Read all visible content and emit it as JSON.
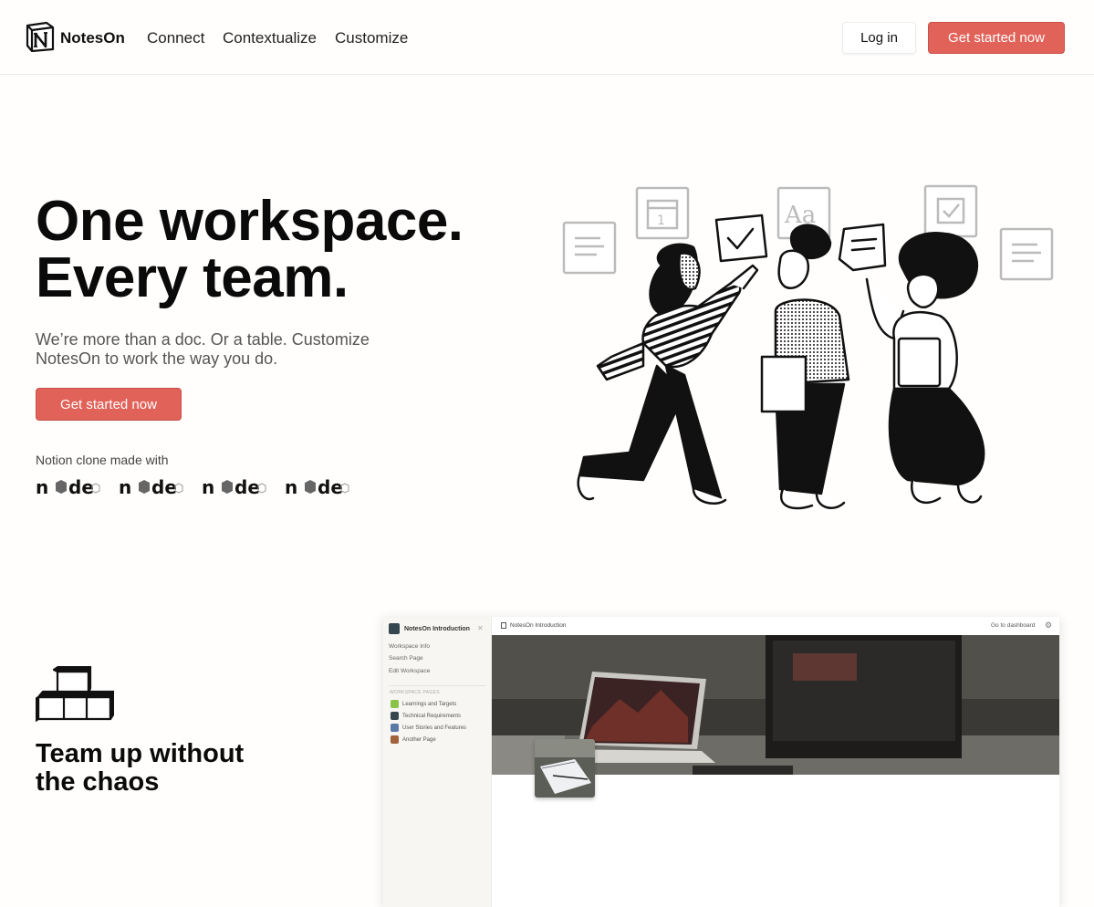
{
  "header": {
    "brand": "NotesOn",
    "nav": [
      "Connect",
      "Contextualize",
      "Customize"
    ],
    "login_label": "Log in",
    "cta_label": "Get started now"
  },
  "hero": {
    "title_line1": "One workspace.",
    "title_line2": "Every team.",
    "subtitle": "We’re more than a doc. Or a table. Customize NotesOn to work the way you do.",
    "cta_label": "Get started now",
    "made_with": "Notion clone made with",
    "tech_logos": [
      "node",
      "node",
      "node",
      "node"
    ]
  },
  "section2": {
    "title_line1": "Team up without",
    "title_line2": "the chaos"
  },
  "app_mock": {
    "workspace_name": "NotesOn Introduction",
    "links": [
      "Workspace Info",
      "Search Page",
      "Edit Workspace"
    ],
    "section_label": "WORKSPACE PAGES",
    "pages": [
      {
        "label": "Learnings and Targets",
        "color": "#8bc34a"
      },
      {
        "label": "Technical Requirements",
        "color": "#37474f"
      },
      {
        "label": "User Stories and Features",
        "color": "#5c7aa8"
      },
      {
        "label": "Another Page",
        "color": "#a0613b"
      }
    ],
    "breadcrumb": "NotesOn Introduction",
    "dashboard_link": "Go to dashboard"
  },
  "colors": {
    "accent": "#e16259",
    "background": "#fffefc",
    "text": "#0a0a0a"
  }
}
